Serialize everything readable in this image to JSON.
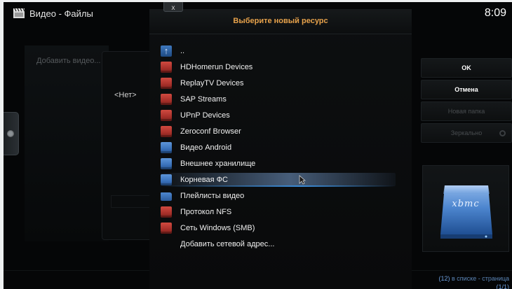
{
  "header": {
    "title": "Видео - Файлы",
    "clock": "8:09"
  },
  "background": {
    "add_video": "Добавить видео...",
    "none_label": "<Нет>",
    "footer_slash": "/"
  },
  "dialog": {
    "title": "Выберите новый ресурс",
    "close_label": "x",
    "items": [
      {
        "label": "..",
        "icon": "up-arrow-icon"
      },
      {
        "label": "HDHomerun Devices",
        "icon": "red-drive-icon"
      },
      {
        "label": "ReplayTV Devices",
        "icon": "red-drive-icon"
      },
      {
        "label": "SAP Streams",
        "icon": "red-drive-icon"
      },
      {
        "label": "UPnP Devices",
        "icon": "red-drive-icon"
      },
      {
        "label": "Zeroconf Browser",
        "icon": "red-drive-icon"
      },
      {
        "label": "Видео Android",
        "icon": "blue-drive-icon"
      },
      {
        "label": "Внешнее хранилище",
        "icon": "blue-drive-icon"
      },
      {
        "label": "Корневая ФС",
        "icon": "blue-drive-icon",
        "selected": true
      },
      {
        "label": "Плейлисты видео",
        "icon": "folder-icon"
      },
      {
        "label": "Протокол NFS",
        "icon": "red-drive-icon"
      },
      {
        "label": "Сеть Windows (SMB)",
        "icon": "red-drive-icon"
      },
      {
        "label": "Добавить сетевой адрес...",
        "icon": ""
      }
    ]
  },
  "buttons": {
    "ok": "OK",
    "cancel": "Отмена",
    "new_folder": "Новая папка",
    "mirror": "Зеркально"
  },
  "thumbnail": {
    "brand": "xbmc",
    "icon": "hard-drive-icon"
  },
  "status": {
    "count": "(12)",
    "text": " в списке - страница",
    "page": "(1/1)"
  },
  "colors": {
    "accent_title": "#e7a24b",
    "selection": "#3a8ad6",
    "status": "#6d9fde"
  }
}
